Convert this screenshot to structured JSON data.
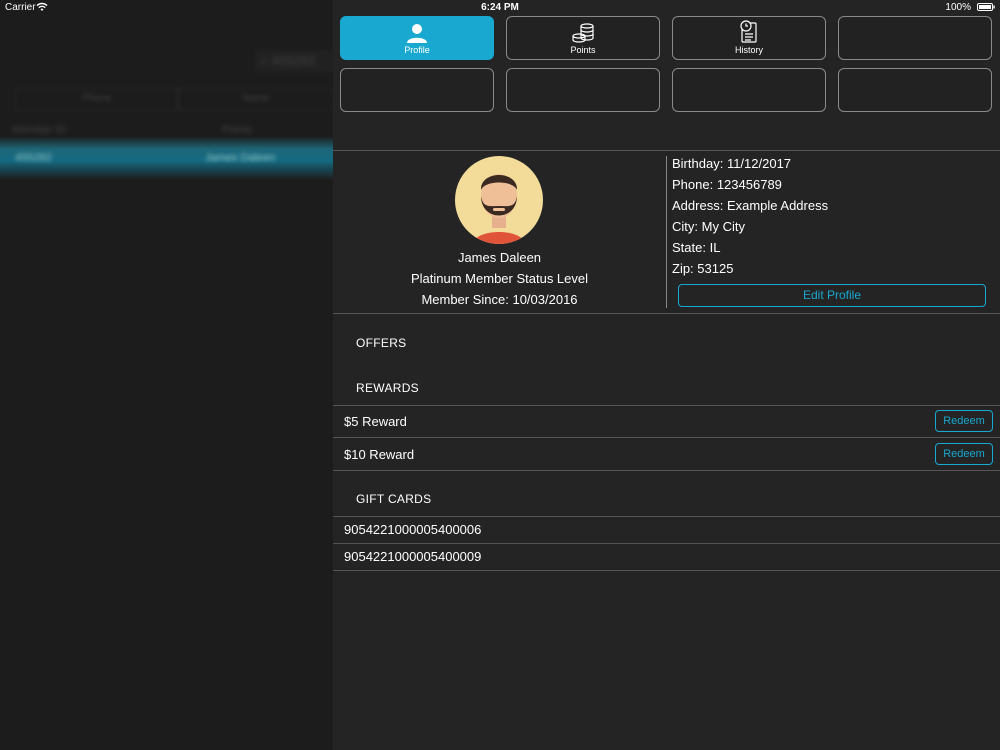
{
  "status_bar": {
    "carrier": "Carrier",
    "time": "6:24 PM",
    "battery": "100%"
  },
  "background_list": {
    "search_value": "455282",
    "col_phone": "Phone",
    "col_name": "Name",
    "row1_left": "Member ID",
    "row1_right": "Points",
    "selected_left": "455282",
    "selected_right": "James Daleen"
  },
  "tabs": [
    {
      "label": "Profile",
      "icon": "person-icon",
      "active": true
    },
    {
      "label": "Points",
      "icon": "coins-icon",
      "active": false
    },
    {
      "label": "History",
      "icon": "history-icon",
      "active": false
    }
  ],
  "profile": {
    "name": "James Daleen",
    "status": "Platinum Member Status Level",
    "member_since": "Member Since: 10/03/2016",
    "birthday_label": "Birthday:",
    "birthday": "11/12/2017",
    "phone_label": "Phone:",
    "phone": "123456789",
    "address_label": "Address:",
    "address": "Example Address",
    "city_label": "City:",
    "city": "My City",
    "state_label": "State:",
    "state": "IL",
    "zip_label": "Zip:",
    "zip": "53125",
    "edit_button": "Edit Profile"
  },
  "offers": {
    "title": "OFFERS"
  },
  "rewards": {
    "title": "REWARDS",
    "items": [
      {
        "label": "$5 Reward",
        "action": "Redeem"
      },
      {
        "label": "$10 Reward",
        "action": "Redeem"
      }
    ]
  },
  "gift_cards": {
    "title": "GIFT CARDS",
    "items": [
      "9054221000005400006",
      "9054221000005400009"
    ]
  },
  "colors": {
    "accent": "#19a8cf",
    "panel_bg": "#242424",
    "left_bg": "#1c1c1c"
  }
}
